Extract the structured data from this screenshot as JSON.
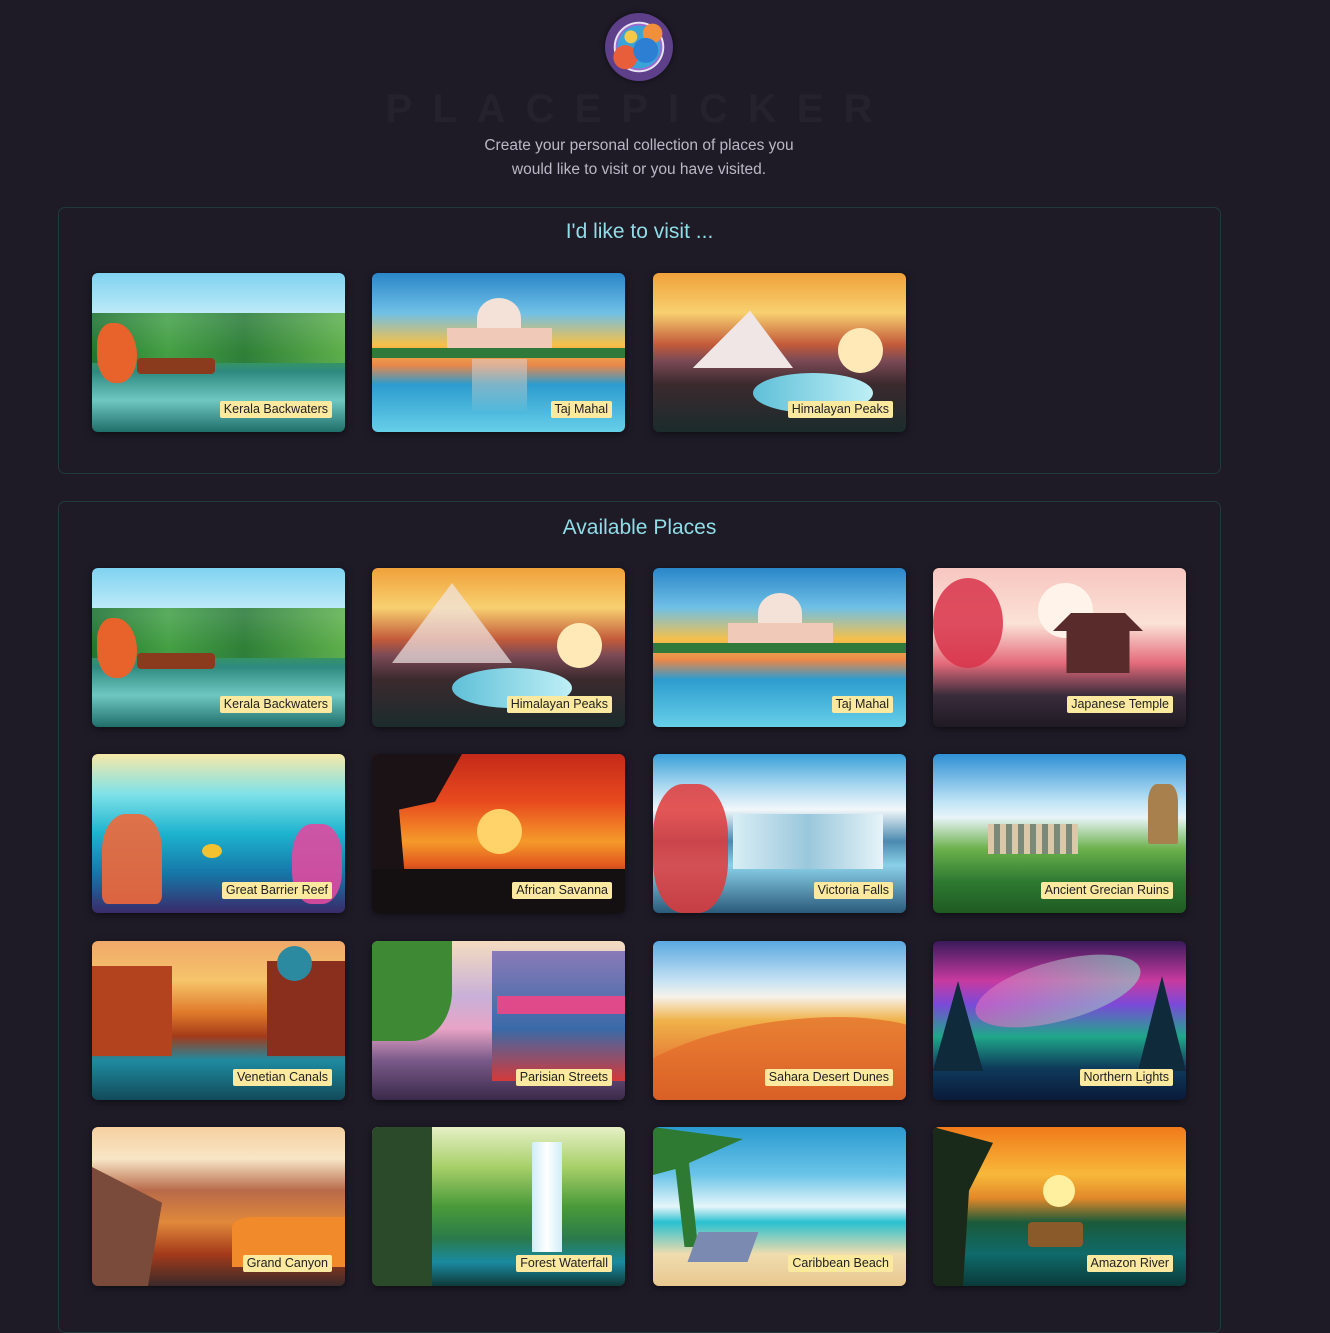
{
  "header": {
    "logo_icon": "globe-logo-icon",
    "brand": "PLACEPICKER",
    "tagline_line1": "Create your personal collection of places you",
    "tagline_line2": "would like to visit or you have visited."
  },
  "favorites": {
    "title": "I'd like to visit ...",
    "places": [
      {
        "name": "Kerala Backwaters"
      },
      {
        "name": "Taj Mahal"
      },
      {
        "name": "Himalayan Peaks"
      }
    ]
  },
  "available": {
    "title": "Available Places",
    "places": [
      {
        "name": "Kerala Backwaters"
      },
      {
        "name": "Himalayan Peaks"
      },
      {
        "name": "Taj Mahal"
      },
      {
        "name": "Japanese Temple"
      },
      {
        "name": "Great Barrier Reef"
      },
      {
        "name": "African Savanna"
      },
      {
        "name": "Victoria Falls"
      },
      {
        "name": "Ancient Grecian Ruins"
      },
      {
        "name": "Venetian Canals"
      },
      {
        "name": "Parisian Streets"
      },
      {
        "name": "Sahara Desert Dunes"
      },
      {
        "name": "Northern Lights"
      },
      {
        "name": "Grand Canyon"
      },
      {
        "name": "Forest Waterfall"
      },
      {
        "name": "Caribbean Beach"
      },
      {
        "name": "Amazon River"
      }
    ]
  },
  "colors": {
    "background": "#1e1b27",
    "section_title": "#8fdde6",
    "label_bg": "#fbe9a0",
    "section_border": "#1f3a3a"
  }
}
